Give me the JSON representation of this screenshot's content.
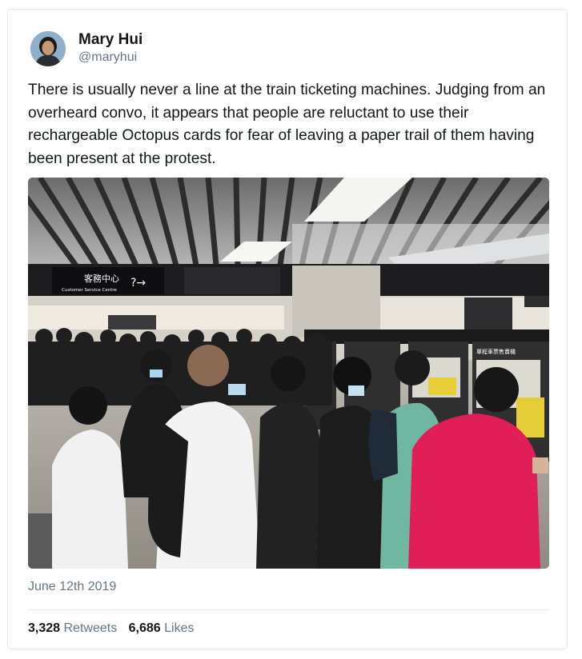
{
  "tweet": {
    "author_name": "Mary Hui",
    "author_handle": "@maryhui",
    "text": "There is usually never a line at the train ticketing machines. Judging from an overheard convo, it appears that people are reluctant to use their rechargeable Octopus cards for fear of leaving a paper trail of them having been present at the protest.",
    "date": "June 12th 2019",
    "retweets_count": "3,328",
    "retweets_label": "Retweets",
    "likes_count": "6,686",
    "likes_label": "Likes"
  },
  "photo": {
    "sign_chinese": "客務中心",
    "sign_english": "Customer Service Centre",
    "machine_sign": "單程車票售賣機"
  },
  "colors": {
    "text": "#14171a",
    "secondary": "#657786",
    "border": "#e1e8ed"
  }
}
